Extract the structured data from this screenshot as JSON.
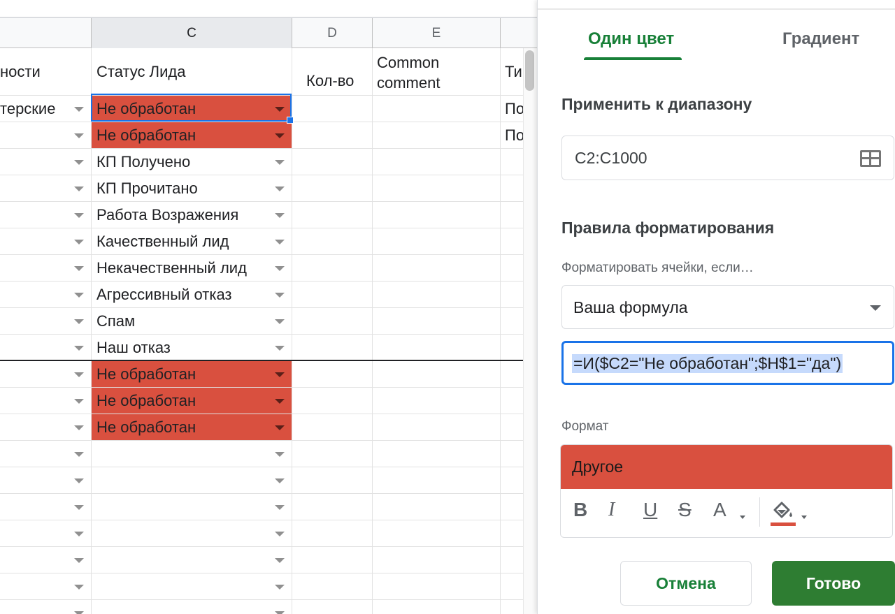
{
  "sheet": {
    "column_headers": [
      "C",
      "D",
      "E"
    ],
    "header_row": {
      "col_b": "ности",
      "col_c": "Статус Лида",
      "col_d": "Кол-во",
      "col_e_line1": "Common",
      "col_e_line2": "comment",
      "col_f": "Ти"
    },
    "rows": [
      {
        "b": "терские",
        "c": "Не обработан",
        "red": true,
        "f": "По"
      },
      {
        "b": "",
        "c": "Не обработан",
        "red": true,
        "f": "По"
      },
      {
        "b": "",
        "c": "КП Получено",
        "red": false,
        "f": ""
      },
      {
        "b": "",
        "c": "КП Прочитано",
        "red": false,
        "f": ""
      },
      {
        "b": "",
        "c": "Работа Возражения",
        "red": false,
        "f": ""
      },
      {
        "b": "",
        "c": "Качественный лид",
        "red": false,
        "f": ""
      },
      {
        "b": "",
        "c": "Некачественный лид",
        "red": false,
        "f": ""
      },
      {
        "b": "",
        "c": "Агрессивный отказ",
        "red": false,
        "f": ""
      },
      {
        "b": "",
        "c": "Спам",
        "red": false,
        "f": ""
      },
      {
        "b": "",
        "c": "Наш отказ",
        "red": false,
        "f": ""
      },
      {
        "b": "",
        "c": "Не обработан",
        "red": true,
        "f": ""
      },
      {
        "b": "",
        "c": "Не обработан",
        "red": true,
        "f": ""
      },
      {
        "b": "",
        "c": "Не обработан",
        "red": true,
        "f": ""
      },
      {
        "b": "",
        "c": "",
        "red": false,
        "f": ""
      },
      {
        "b": "",
        "c": "",
        "red": false,
        "f": ""
      },
      {
        "b": "",
        "c": "",
        "red": false,
        "f": ""
      },
      {
        "b": "",
        "c": "",
        "red": false,
        "f": ""
      },
      {
        "b": "",
        "c": "",
        "red": false,
        "f": ""
      },
      {
        "b": "",
        "c": "",
        "red": false,
        "f": ""
      },
      {
        "b": "",
        "c": "",
        "red": false,
        "f": ""
      }
    ]
  },
  "panel": {
    "tabs": {
      "solid": "Один цвет",
      "gradient": "Градиент"
    },
    "apply_range_title": "Применить к диапазону",
    "range_value": "C2:C1000",
    "rules_title": "Правила форматирования",
    "condition_label": "Форматировать ячейки, если…",
    "condition_value": "Ваша формула",
    "formula": "=И($C2=\"Не обработан\";$H$1=\"да\")",
    "format_label": "Формат",
    "format_preview": "Другое",
    "toolbar": {
      "bold": "B",
      "italic": "I",
      "underline": "U",
      "strike": "S",
      "text_color": "A"
    },
    "buttons": {
      "cancel": "Отмена",
      "done": "Готово"
    }
  },
  "colors": {
    "accent_green": "#188038",
    "done_button": "#2e7d32",
    "highlight_red": "#d9503f",
    "selection_blue": "#1a73e8"
  },
  "icons": [
    "dropdown-arrow-icon",
    "grid-select-icon",
    "caret-down-icon",
    "fill-color-icon"
  ]
}
